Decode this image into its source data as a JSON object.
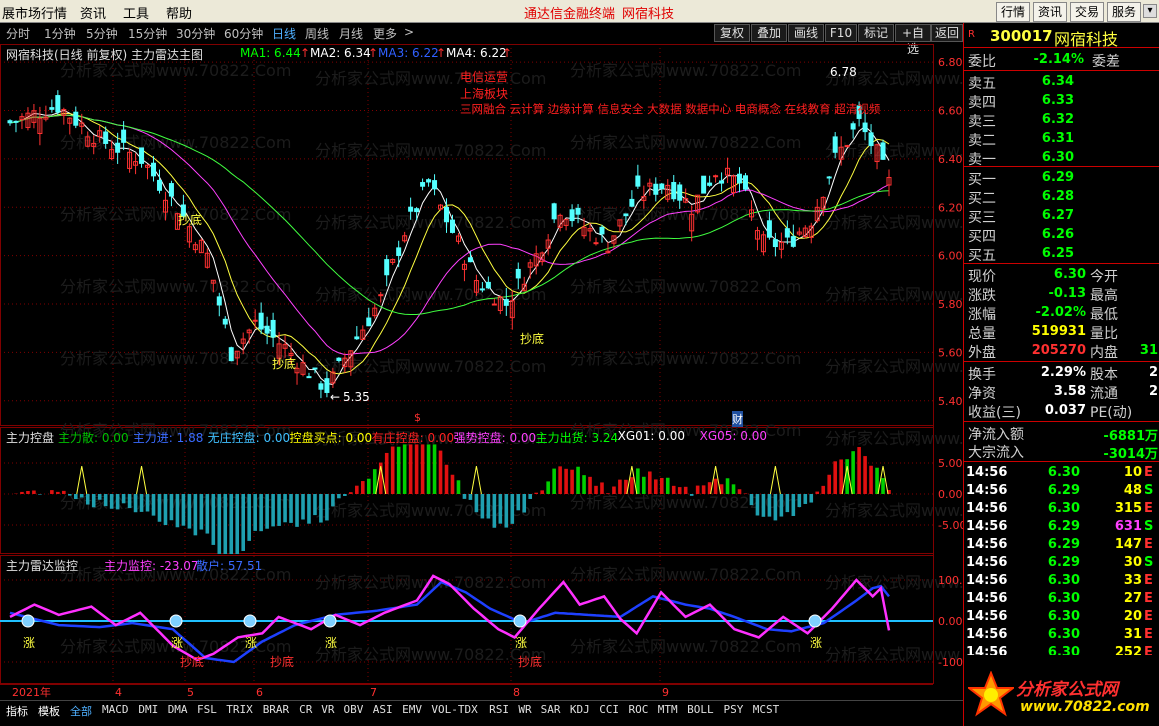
{
  "menu": {
    "items": [
      "展市场行情",
      "资讯",
      "工具",
      "帮助"
    ],
    "brand_left": "通达信金融终端",
    "brand_right": "网宿科技",
    "right_buttons": [
      "行情",
      "资讯",
      "交易",
      "服务"
    ]
  },
  "toolbar": {
    "periods": [
      "分时",
      "1分钟",
      "5分钟",
      "15分钟",
      "30分钟",
      "60分钟",
      "日线",
      "周线",
      "月线",
      "更多"
    ],
    "more_arrow": ">",
    "buttons": [
      "复权",
      "叠加",
      "画线",
      "F10",
      "标记",
      "+自选",
      "返回"
    ]
  },
  "main_chart": {
    "title": "网宿科技(日线 前复权) 主力雷达主图",
    "ma": [
      {
        "label": "MA1: 6.44",
        "color": "#00ff00"
      },
      {
        "label": "MA2: 6.34",
        "color": "#ffffff"
      },
      {
        "label": "MA3: 6.22",
        "color": "#3060ff"
      },
      {
        "label": "MA4: 6.22",
        "color": "#ffffff"
      }
    ],
    "concept_lines": [
      "电信运营",
      "上海板块",
      "三网融合 云计算 边缘计算 信息安全 大数据 数据中心 电商概念 在线教育 超清视频"
    ],
    "annotations": {
      "high": "6.78",
      "low": "5.35",
      "chaodi": "抄底"
    },
    "y_ticks": [
      "6.80",
      "6.60",
      "6.40",
      "6.20",
      "6.00",
      "5.80",
      "5.60",
      "5.40"
    ],
    "markers": {
      "s": "$",
      "cai": "财"
    }
  },
  "chart_data": {
    "type": "candlestick",
    "y_range": [
      5.3,
      6.85
    ],
    "x_label_months": [
      "2021年",
      "4",
      "5",
      "6",
      "7",
      "8",
      "9"
    ],
    "watermark": "分析家公式网www.70822.Com",
    "indicators": {
      "panel2": {
        "name": "主力控盘",
        "items": [
          {
            "label": "主力散: 0.00",
            "color": "#00c000"
          },
          {
            "label": "主力进: 1.88",
            "color": "#3a6bff"
          },
          {
            "label": "无庄控盘: 0.00",
            "color": "#40c0ff"
          },
          {
            "label": "控盘买点: 0.00",
            "color": "#ffff00"
          },
          {
            "label": "有庄控盘: 0.00",
            "color": "#ff2020"
          },
          {
            "label": "强势控盘: 0.00",
            "color": "#ff40ff"
          },
          {
            "label": "主力出货: 3.24",
            "color": "#00ff00"
          },
          {
            "label": "XG01: 0.00",
            "color": "#ffffff"
          },
          {
            "label": "XG05: 0.00",
            "color": "#ff40ff"
          }
        ],
        "y_ticks": [
          "5.00",
          "0.00",
          "-5.00"
        ]
      },
      "panel3": {
        "name": "主力雷达监控",
        "items": [
          {
            "label": "主力监控: -23.07",
            "color": "#ff40ff"
          },
          {
            "label": "散户: 57.51",
            "color": "#3a6bff"
          }
        ],
        "y_ticks": [
          "100.0",
          "0.00",
          "-100.0"
        ],
        "zhang": "涨",
        "chaodi": "抄底"
      }
    }
  },
  "quote": {
    "flag": "R",
    "code": "300017",
    "name": "网宿科技",
    "weibi_label": "委比",
    "weibi": "-2.14%",
    "weicha_label": "委差",
    "asks": [
      {
        "label": "卖五",
        "price": "6.34"
      },
      {
        "label": "卖四",
        "price": "6.33"
      },
      {
        "label": "卖三",
        "price": "6.32"
      },
      {
        "label": "卖二",
        "price": "6.31"
      },
      {
        "label": "卖一",
        "price": "6.30"
      }
    ],
    "bids": [
      {
        "label": "买一",
        "price": "6.29"
      },
      {
        "label": "买二",
        "price": "6.28"
      },
      {
        "label": "买三",
        "price": "6.27"
      },
      {
        "label": "买四",
        "price": "6.26"
      },
      {
        "label": "买五",
        "price": "6.25"
      }
    ],
    "stats": [
      {
        "label": "现价",
        "value": "6.30",
        "color": "#00ff00",
        "label2": "今开",
        "value2": ""
      },
      {
        "label": "涨跌",
        "value": "-0.13",
        "color": "#00ff00",
        "label2": "最高",
        "value2": ""
      },
      {
        "label": "涨幅",
        "value": "-2.02%",
        "color": "#00ff00",
        "label2": "最低",
        "value2": ""
      },
      {
        "label": "总量",
        "value": "519931",
        "color": "#ffff00",
        "label2": "量比",
        "value2": ""
      },
      {
        "label": "外盘",
        "value": "205270",
        "color": "#ff3030",
        "label2": "内盘",
        "value2": "31"
      }
    ],
    "stats2": [
      {
        "label": "换手",
        "value": "2.29%",
        "label2": "股本",
        "value2": "2"
      },
      {
        "label": "净资",
        "value": "3.58",
        "label2": "流通",
        "value2": "2"
      },
      {
        "label": "收益(三)",
        "value": "0.037",
        "label2": "PE(动)",
        "value2": ""
      }
    ],
    "flows": [
      {
        "label": "净流入额",
        "value": "-6881万"
      },
      {
        "label": "大宗流入",
        "value": "-3014万"
      }
    ],
    "ticks": [
      {
        "time": "14:56",
        "price": "6.30",
        "vol": "10",
        "vcolor": "#ffff00",
        "side": "E"
      },
      {
        "time": "14:56",
        "price": "6.29",
        "vol": "48",
        "vcolor": "#ffff00",
        "side": "S"
      },
      {
        "time": "14:56",
        "price": "6.30",
        "vol": "315",
        "vcolor": "#ffff00",
        "side": "E"
      },
      {
        "time": "14:56",
        "price": "6.29",
        "vol": "631",
        "vcolor": "#ff40ff",
        "side": "S"
      },
      {
        "time": "14:56",
        "price": "6.29",
        "vol": "147",
        "vcolor": "#ffff00",
        "side": "E"
      },
      {
        "time": "14:56",
        "price": "6.29",
        "vol": "30",
        "vcolor": "#ffff00",
        "side": "S"
      },
      {
        "time": "14:56",
        "price": "6.30",
        "vol": "33",
        "vcolor": "#ffff00",
        "side": "E"
      },
      {
        "time": "14:56",
        "price": "6.30",
        "vol": "27",
        "vcolor": "#ffff00",
        "side": "E"
      },
      {
        "time": "14:56",
        "price": "6.30",
        "vol": "20",
        "vcolor": "#ffff00",
        "side": "E"
      },
      {
        "time": "14:56",
        "price": "6.30",
        "vol": "31",
        "vcolor": "#ffff00",
        "side": "E"
      },
      {
        "time": "14:56",
        "price": "6.30",
        "vol": "252",
        "vcolor": "#ffff00",
        "side": "E"
      }
    ],
    "right_tab": "日线"
  },
  "bottom_tabs": [
    "指标",
    "模板",
    "全部",
    "MACD",
    "DMI",
    "DMA",
    "FSL",
    "TRIX",
    "BRAR",
    "CR",
    "VR",
    "OBV",
    "ASI",
    "EMV",
    "VOL-TDX",
    "RSI",
    "WR",
    "SAR",
    "KDJ",
    "CCI",
    "ROC",
    "MTM",
    "BOLL",
    "PSY",
    "MCST"
  ],
  "logo": {
    "text": "分析家公式网",
    "url": "www.70822.com"
  },
  "colors": {
    "up": "#ff3232",
    "down": "#54ffff",
    "bg": "#000000",
    "grid": "#800000"
  }
}
